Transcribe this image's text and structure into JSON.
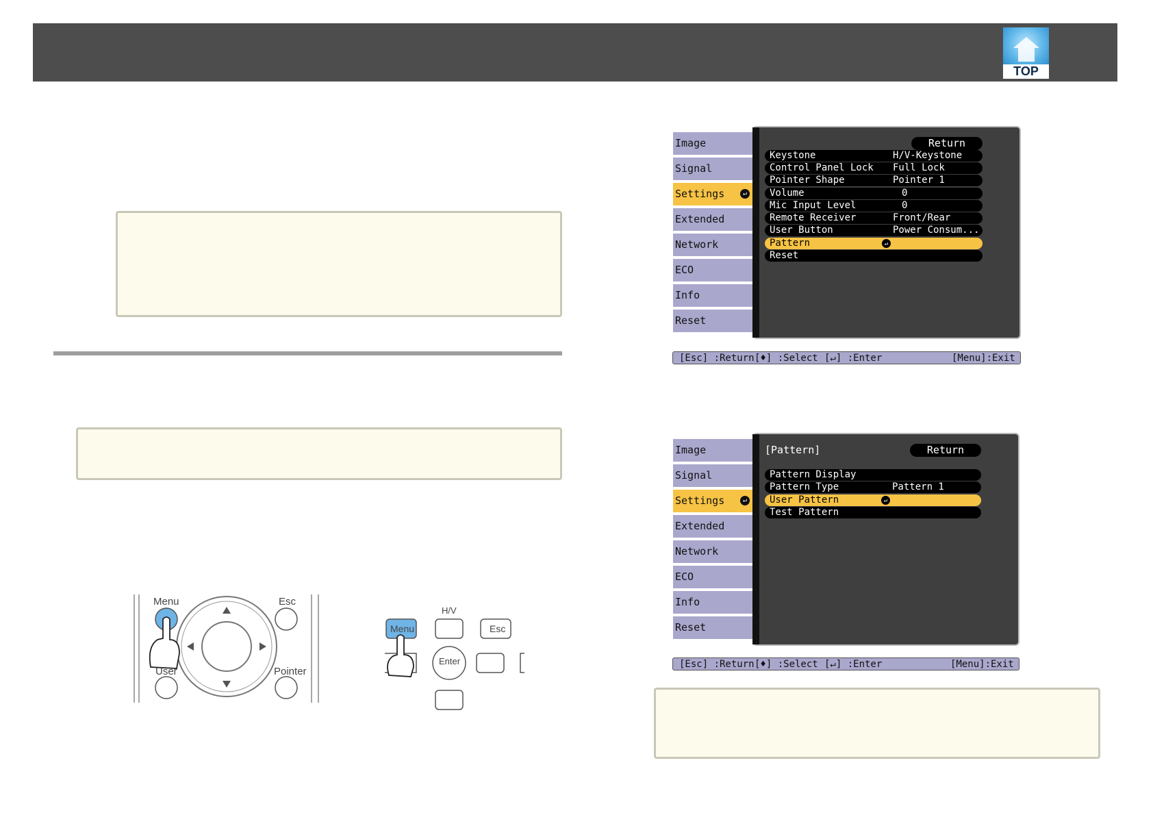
{
  "header": {
    "top_label": "TOP"
  },
  "menu1": {
    "tabs": [
      "Image",
      "Signal",
      "Settings",
      "Extended",
      "Network",
      "ECO",
      "Info",
      "Reset"
    ],
    "active_tab": "Settings",
    "return_label": "Return",
    "rows": [
      {
        "label": "Keystone",
        "value": "H/V-Keystone"
      },
      {
        "label": "Control Panel Lock",
        "value": "Full Lock"
      },
      {
        "label": "Pointer Shape",
        "value": "Pointer 1"
      },
      {
        "label": "Volume",
        "value": "0"
      },
      {
        "label": "Mic Input Level",
        "value": "0"
      },
      {
        "label": "Remote Receiver",
        "value": "Front/Rear"
      },
      {
        "label": "User Button",
        "value": "Power Consum..."
      },
      {
        "label": "Pattern",
        "value": ""
      },
      {
        "label": "Reset",
        "value": ""
      }
    ],
    "footer": {
      "esc": "[Esc] :Return",
      "select": "[♦] :Select",
      "enter": "[↵] :Enter",
      "exit": "[Menu]:Exit"
    }
  },
  "menu2": {
    "tabs": [
      "Image",
      "Signal",
      "Settings",
      "Extended",
      "Network",
      "ECO",
      "Info",
      "Reset"
    ],
    "title": "[Pattern]",
    "return_label": "Return",
    "rows": [
      {
        "label": "Pattern Display",
        "value": ""
      },
      {
        "label": "Pattern Type",
        "value": "Pattern 1"
      },
      {
        "label": "User Pattern",
        "value": ""
      },
      {
        "label": "Test Pattern",
        "value": ""
      }
    ],
    "footer": {
      "esc": "[Esc] :Return",
      "select": "[♦] :Select",
      "enter": "[↵] :Enter",
      "exit": "[Menu]:Exit"
    }
  },
  "remote": {
    "menu": "Menu",
    "esc": "Esc",
    "user": "User",
    "pointer": "Pointer"
  },
  "control_panel": {
    "hv": "H/V",
    "menu": "Menu",
    "esc": "Esc",
    "enter": "Enter"
  },
  "colors": {
    "header": "#4d4d4d",
    "tab": "#a9a7cc",
    "highlight": "#f7c344",
    "note_bg": "#fdfbeb"
  }
}
